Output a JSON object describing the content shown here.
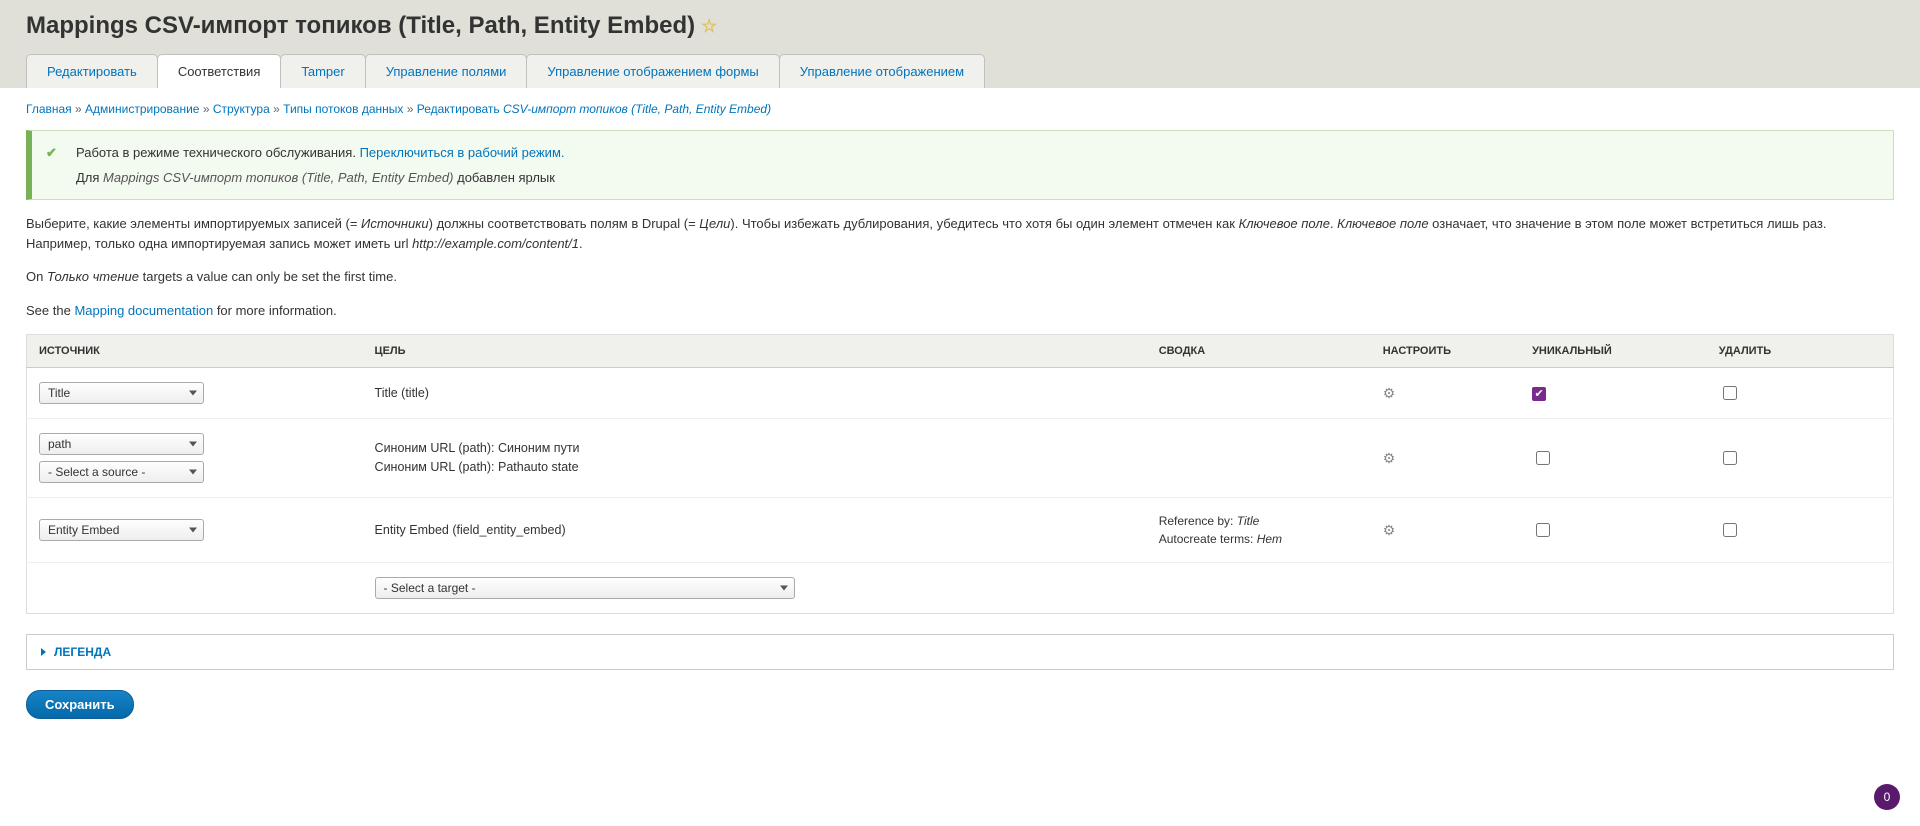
{
  "page_title": "Mappings CSV-импорт топиков (Title, Path, Entity Embed)",
  "tabs": [
    {
      "label": "Редактировать",
      "active": false
    },
    {
      "label": "Соответствия",
      "active": true
    },
    {
      "label": "Tamper",
      "active": false
    },
    {
      "label": "Управление полями",
      "active": false
    },
    {
      "label": "Управление отображением формы",
      "active": false
    },
    {
      "label": "Управление отображением",
      "active": false
    }
  ],
  "breadcrumb": {
    "items": [
      "Главная",
      "Администрирование",
      "Структура",
      "Типы потоков данных"
    ],
    "current_prefix": "Редактировать ",
    "current": "CSV-импорт топиков (Title, Path, Entity Embed)",
    "sep": " » "
  },
  "messages": {
    "line1_a": "Работа в режиме технического обслуживания. ",
    "line1_link": "Переключиться в рабочий режим.",
    "line2_a": "Для ",
    "line2_em": "Mappings CSV-импорт топиков (Title, Path, Entity Embed)",
    "line2_b": " добавлен ярлык"
  },
  "help": {
    "p1_a": "Выберите, какие элементы импортируемых записей (= ",
    "p1_em1": "Источники",
    "p1_b": ") должны соответствовать полям в Drupal (= ",
    "p1_em2": "Цели",
    "p1_c": "). Чтобы избежать дублирования, убедитесь что хотя бы один элемент отмечен как ",
    "p1_em3": "Ключевое поле",
    "p1_d": ". ",
    "p1_em4": "Ключевое поле",
    "p1_e": " означает, что значение в этом поле может встретиться лишь раз. Например, только одна импортируемая запись может иметь url ",
    "p1_em5": "http://example.com/content/1",
    "p1_f": ".",
    "p2_a": "On ",
    "p2_em": "Только чтение",
    "p2_b": " targets a value can only be set the first time.",
    "p3_a": "See the ",
    "p3_link": "Mapping documentation",
    "p3_b": " for more information."
  },
  "table": {
    "headers": {
      "source": "Источник",
      "target": "Цель",
      "summary": "Сводка",
      "configure": "Настроить",
      "unique": "Уникальный",
      "delete": "Удалить"
    },
    "rows": [
      {
        "sources": [
          "Title"
        ],
        "target": "Title (title)",
        "summary": "",
        "has_gear": true,
        "unique_checked": true
      },
      {
        "sources": [
          "path",
          "- Select a source -"
        ],
        "target": "Синоним URL (path): Синоним пути\nСиноним URL (path): Pathauto state",
        "summary": "",
        "has_gear": true,
        "unique_checked": false
      },
      {
        "sources": [
          "Entity Embed"
        ],
        "target": "Entity Embed (field_entity_embed)",
        "summary_ref_label": "Reference by: ",
        "summary_ref_value": "Title",
        "summary_auto_label": "Autocreate terms: ",
        "summary_auto_value": "Нет",
        "has_gear": true,
        "unique_checked": false
      }
    ],
    "new_target_placeholder": "- Select a target -"
  },
  "legend_label": "Легенда",
  "save_label": "Сохранить",
  "fab_value": "0"
}
